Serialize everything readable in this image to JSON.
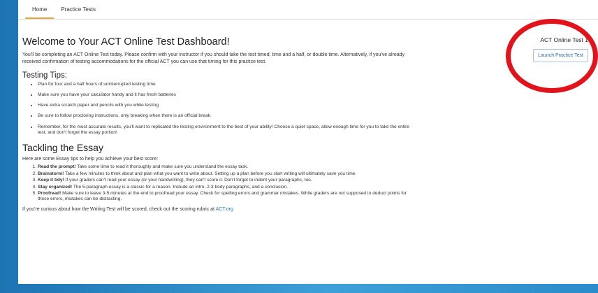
{
  "nav": {
    "tabs": [
      {
        "label": "Home",
        "active": true
      },
      {
        "label": "Practice Tests",
        "active": false
      }
    ]
  },
  "main": {
    "title": "Welcome to Your ACT Online Test Dashboard!",
    "intro": "You'll be completing an ACT Online Test today. Please confirm with your instructor if you should take the test timed, time and a half, or double time. Alternatively, if you've already received confirmation of testing accommodations for the official ACT you can use that timing for this practice test.",
    "tips_heading": "Testing Tips:",
    "tips": [
      "Plan for four and a half hours of uninterrupted testing time",
      "Make sure you have your calculator handy and it has fresh batteries",
      "Have extra scratch paper and pencils with you while testing",
      "Be sure to follow proctoring instructions, only breaking when there is an official break.",
      "Remember, for the most accurate results, you'll want to replicated the testing environment to the best of your ability! Choose a quiet space, allow enough time for you to take the entire test, and don't forget the essay portion!"
    ],
    "essay_heading": "Tackling the Essay",
    "essay_intro": "Here are some Essay tips to help you achieve your best score:",
    "essay_tips": [
      {
        "bold": "Read the prompt!",
        "text": " Take some time to read it thoroughly and make sure you understand the essay task."
      },
      {
        "bold": "Brainstorm!",
        "text": " Take a few minutes to think about and plan what you want to write about. Setting up a plan before you start writing will ultimately save you time."
      },
      {
        "bold": "Keep it tidy!",
        "text": " If your graders can't read your essay (or your handwriting), they can't score it. Don't forget to indent your paragraphs, too."
      },
      {
        "bold": "Stay organized!",
        "text": " The 5-paragraph essay is a classic for a reason. Include an intro, 2-3 body paragraphs, and a conclusion."
      },
      {
        "bold": "Proofread!",
        "text": " Make sure to leave 3-5 minutes at the end to proofread your essay. Check for spelling errors and grammar mistakes. While graders are not supposed to deduct points for these errors, mistakes can be distracting."
      }
    ],
    "footer_text": "If you're curious about how the Writing Test will be scored, check out the scoring rubric at ",
    "footer_link": "ACT.org"
  },
  "side": {
    "test_title": "ACT Online Test 1",
    "launch_label": "Launch Practice Test"
  },
  "colors": {
    "background": "#2a86c2",
    "accent_underline": "#e8a33c",
    "link": "#2b7bb9",
    "highlight_ring": "#e3131b"
  }
}
